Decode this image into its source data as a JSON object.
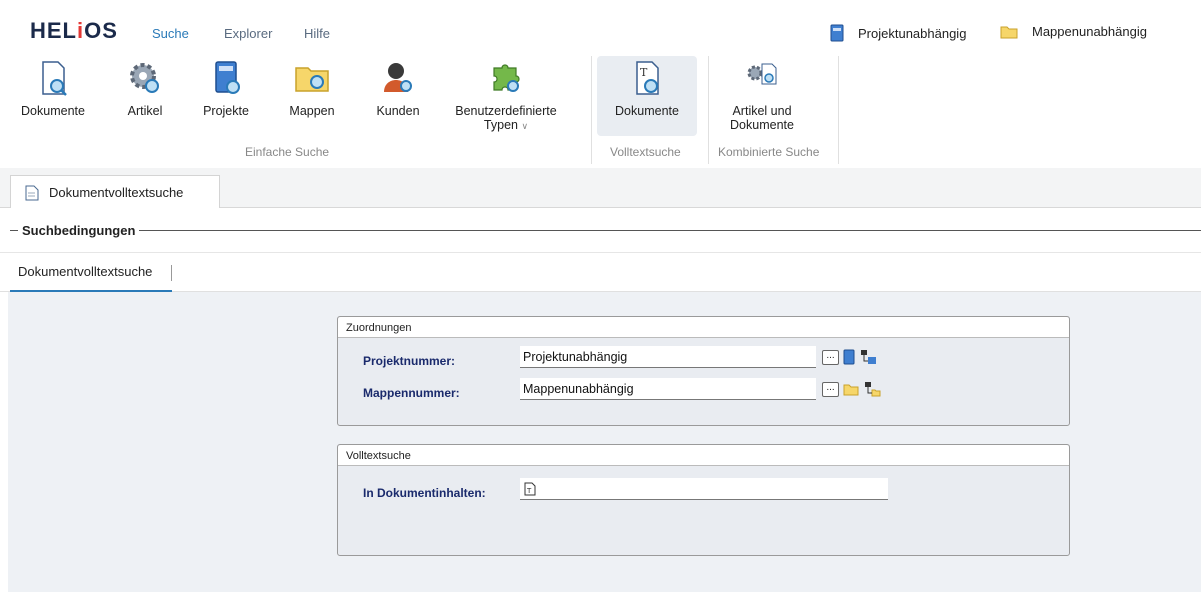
{
  "app": {
    "logo": "HELIOS"
  },
  "menubar": {
    "items": [
      "Suche",
      "Explorer",
      "Hilfe"
    ],
    "context_project": "Projektunabhängig",
    "context_folder": "Mappenunabhängig"
  },
  "ribbon": {
    "buttons": {
      "dokumente": "Dokumente",
      "artikel": "Artikel",
      "projekte": "Projekte",
      "mappen": "Mappen",
      "kunden": "Kunden",
      "benutzerdefinierte_1": "Benutzerdefinierte",
      "benutzerdefinierte_2": "Typen",
      "volltext_dokumente": "Dokumente",
      "kombi_1": "Artikel und",
      "kombi_2": "Dokumente"
    },
    "groups": {
      "einfache": "Einfache Suche",
      "volltext": "Volltextsuche",
      "kombiniert": "Kombinierte Suche"
    }
  },
  "tabs": {
    "main": "Dokumentvolltextsuche"
  },
  "conditions": {
    "title": "Suchbedingungen"
  },
  "subtabs": {
    "active": "Dokumentvolltextsuche"
  },
  "zuordnungen": {
    "title": "Zuordnungen",
    "projekt_label": "Projektnummer:",
    "projekt_value": "Projektunabhängig",
    "mappe_label": "Mappennummer:",
    "mappe_value": "Mappenunabhängig",
    "dots": "..."
  },
  "volltextsuche": {
    "title": "Volltextsuche",
    "inhalt_label": "In Dokumentinhalten:",
    "inhalt_value": ""
  },
  "colors": {
    "accent": "#2a7ab8",
    "label": "#1a2a6c",
    "content_bg": "#eef1f5"
  }
}
